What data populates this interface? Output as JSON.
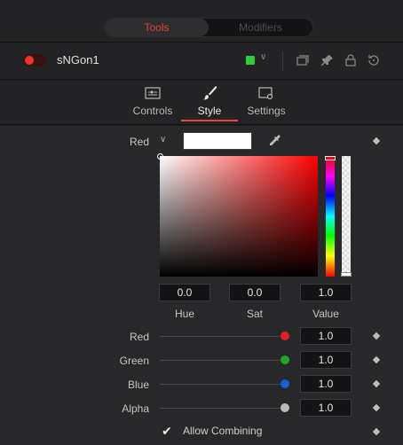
{
  "tabs": {
    "tools": "Tools",
    "modifiers": "Modifiers"
  },
  "node": {
    "name": "sNGon1",
    "color": "#2cd13a",
    "toggle_color": "#e8372c"
  },
  "subtabs": [
    {
      "label": "Controls",
      "icon": "controls-icon"
    },
    {
      "label": "Style",
      "icon": "brush-icon"
    },
    {
      "label": "Settings",
      "icon": "settings-icon"
    }
  ],
  "color_picker": {
    "channel": "Red",
    "swatch": "#ffffff",
    "hue": "0.0",
    "sat": "0.0",
    "value": "1.0",
    "hue_label": "Hue",
    "sat_label": "Sat",
    "value_label": "Value"
  },
  "sliders": [
    {
      "label": "Red",
      "value": "1.0",
      "color": "#e02020"
    },
    {
      "label": "Green",
      "value": "1.0",
      "color": "#1fa72a"
    },
    {
      "label": "Blue",
      "value": "1.0",
      "color": "#1a5fd6"
    },
    {
      "label": "Alpha",
      "value": "1.0",
      "color": "#b8b8b8"
    }
  ],
  "allow_combining": {
    "label": "Allow Combining",
    "checked": true
  }
}
